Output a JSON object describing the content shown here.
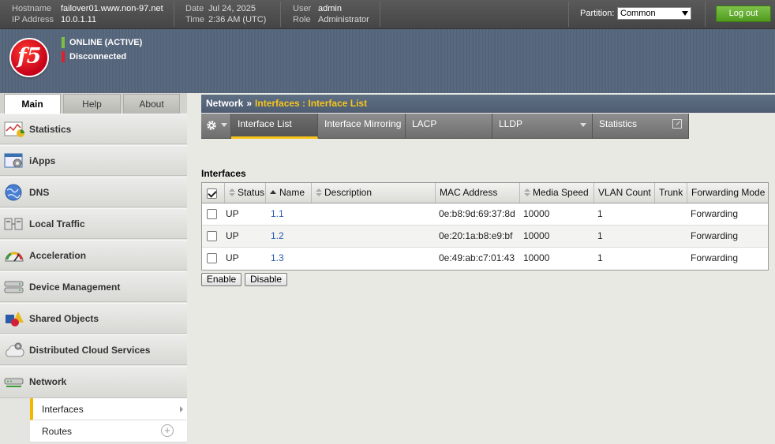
{
  "topbar": {
    "hostname_label": "Hostname",
    "hostname": "failover01.www.non-97.net",
    "ip_label": "IP Address",
    "ip": "10.0.1.11",
    "date_label": "Date",
    "date": "Jul 24, 2025",
    "time_label": "Time",
    "time": "2:36 AM (UTC)",
    "user_label": "User",
    "user": "admin",
    "role_label": "Role",
    "role": "Administrator",
    "partition_label": "Partition:",
    "partition_value": "Common",
    "logout_label": "Log out"
  },
  "banner": {
    "logo_text": "f5",
    "status_online": "ONLINE (ACTIVE)",
    "status_sync": "Disconnected",
    "colors": {
      "online": "#7ac143",
      "disconnected": "#e0202e"
    }
  },
  "nav_tabs": [
    "Main",
    "Help",
    "About"
  ],
  "nav": {
    "items": [
      {
        "label": "Statistics",
        "icon": "statistics-icon"
      },
      {
        "label": "iApps",
        "icon": "iapps-icon"
      },
      {
        "label": "DNS",
        "icon": "dns-globe-icon"
      },
      {
        "label": "Local Traffic",
        "icon": "local-traffic-icon"
      },
      {
        "label": "Acceleration",
        "icon": "acceleration-gauge-icon"
      },
      {
        "label": "Device Management",
        "icon": "device-management-icon"
      },
      {
        "label": "Shared Objects",
        "icon": "shared-objects-icon"
      },
      {
        "label": "Distributed Cloud Services",
        "icon": "cloud-gear-icon"
      },
      {
        "label": "Network",
        "icon": "network-icon"
      }
    ],
    "sub_items": [
      {
        "label": "Interfaces"
      },
      {
        "label": "Routes"
      }
    ]
  },
  "breadcrumb": {
    "root": "Network",
    "separator": "»",
    "current": "Interfaces : Interface List"
  },
  "tabs": [
    {
      "label": "Interface List"
    },
    {
      "label": "Interface Mirroring"
    },
    {
      "label": "LACP"
    },
    {
      "label": "LLDP"
    },
    {
      "label": "Statistics"
    }
  ],
  "section_title": "Interfaces",
  "table": {
    "columns": [
      "Status",
      "Name",
      "Description",
      "MAC Address",
      "Media Speed",
      "VLAN Count",
      "Trunk",
      "Forwarding Mode"
    ],
    "rows": [
      {
        "status": "UP",
        "name": "1.1",
        "description": "",
        "mac": "0e:b8:9d:69:37:8d",
        "speed": "10000",
        "vlan_count": "1",
        "trunk": "",
        "forwarding": "Forwarding"
      },
      {
        "status": "UP",
        "name": "1.2",
        "description": "",
        "mac": "0e:20:1a:b8:e9:bf",
        "speed": "10000",
        "vlan_count": "1",
        "trunk": "",
        "forwarding": "Forwarding"
      },
      {
        "status": "UP",
        "name": "1.3",
        "description": "",
        "mac": "0e:49:ab:c7:01:43",
        "speed": "10000",
        "vlan_count": "1",
        "trunk": "",
        "forwarding": "Forwarding"
      }
    ]
  },
  "buttons": {
    "enable": "Enable",
    "disable": "Disable"
  }
}
